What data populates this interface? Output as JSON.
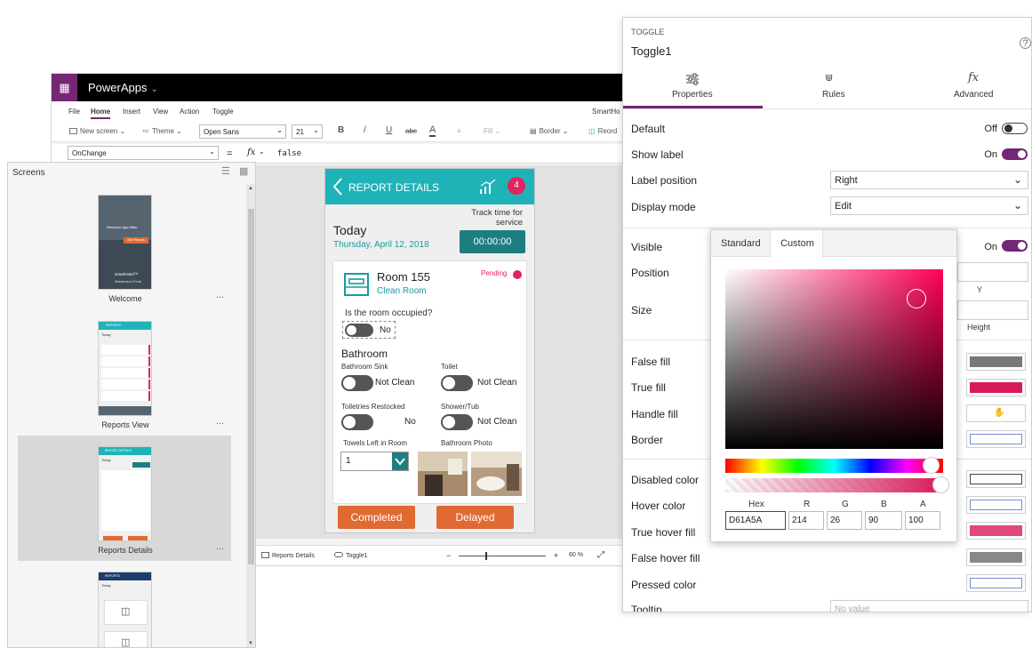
{
  "app": {
    "title": "PowerApps",
    "waffle": "waffle-icon",
    "chev": "⌄"
  },
  "menu": {
    "items": [
      "File",
      "Home",
      "Insert",
      "View",
      "Action",
      "Toggle"
    ],
    "active": "Home",
    "right": "SmartHo"
  },
  "toolbar": {
    "new_screen": "New screen ⌄",
    "theme": "Theme ⌄",
    "font": "Open Sans",
    "size": "21",
    "bold": "B",
    "italic": "/",
    "underline": "U",
    "strike": "abc",
    "color": "A",
    "align": "≡",
    "fill": "Fill ⌄",
    "border": "Border ⌄",
    "reorder": "Reord"
  },
  "formula": {
    "property": "OnChange",
    "eq": "=",
    "fx": "fx",
    "value": "false"
  },
  "screens_panel": {
    "title": "Screens",
    "items": [
      {
        "label": "Welcome",
        "title": "Welcome App Main",
        "btn": "See Reports",
        "brand": "smartHotel™",
        "sub": "Maintenance Portal"
      },
      {
        "label": "Reports View",
        "header": "REPORTS"
      },
      {
        "label": "Reports Details",
        "header": "REPORT DETAILS"
      },
      {
        "label": "",
        "header": "REPORTS"
      }
    ],
    "dots": "...",
    "today": "Today"
  },
  "phone": {
    "header_title": "REPORT DETAILS",
    "badge": "4",
    "today": "Today",
    "date": "Thursday, April 12, 2018",
    "track_label": "Track time for service",
    "timer": "00:00:00",
    "room": "Room 155",
    "room_sub": "Clean Room",
    "status": "Pending",
    "occupied_q": "Is the room occupied?",
    "occupied_val": "No",
    "bathroom": "Bathroom",
    "fields": [
      {
        "label": "Bathroom Sink",
        "value": "Not Clean"
      },
      {
        "label": "Toilet",
        "value": "Not Clean"
      },
      {
        "label": "Toiletries Restocked",
        "value": "No"
      },
      {
        "label": "Shower/Tub",
        "value": "Not Clean"
      }
    ],
    "towels_label": "Towels Left in Room",
    "towels_val": "1",
    "photo_label": "Bathroom Photo",
    "btn_completed": "Completed",
    "btn_delayed": "Delayed"
  },
  "status": {
    "screen": "Reports Details",
    "control": "Toggle1",
    "zoom": "60 %",
    "minus": "−",
    "plus": "+"
  },
  "props": {
    "type": "TOGGLE",
    "name": "Toggle1",
    "help": "?",
    "tabs": [
      {
        "label": "Properties",
        "icon": "properties-icon"
      },
      {
        "label": "Rules",
        "icon": "rules-icon"
      },
      {
        "label": "Advanced",
        "icon": "fx-icon"
      }
    ],
    "default_label": "Default",
    "default_val": "Off",
    "showlabel_label": "Show label",
    "showlabel_val": "On",
    "labelpos_label": "Label position",
    "labelpos_val": "Right",
    "displaymode_label": "Display mode",
    "displaymode_val": "Edit",
    "visible_label": "Visible",
    "visible_val": "On",
    "position_label": "Position",
    "y_label": "Y",
    "size_label": "Size",
    "height_label": "Height",
    "colors": [
      {
        "label": "False fill",
        "color": "#777777"
      },
      {
        "label": "True fill",
        "color": "#D61A5A"
      },
      {
        "label": "Handle fill",
        "color": "#FFFFFF"
      },
      {
        "label": "Border",
        "color": "#FFFFFF"
      },
      {
        "label": "Disabled color",
        "color": "#FFFFFF"
      },
      {
        "label": "Hover color",
        "color": "#FFFFFF"
      },
      {
        "label": "True hover fill",
        "color": "#E0487A"
      },
      {
        "label": "False hover fill",
        "color": "#888888"
      },
      {
        "label": "Pressed color",
        "color": "#FFFFFF"
      }
    ],
    "tooltip_label": "Tooltip",
    "tooltip_placeholder": "No value"
  },
  "picker": {
    "tabs": [
      "Standard",
      "Custom"
    ],
    "active": "Custom",
    "hex_label": "Hex",
    "r_label": "R",
    "g_label": "G",
    "b_label": "B",
    "a_label": "A",
    "hex": "D61A5A",
    "r": "214",
    "g": "26",
    "b": "90",
    "a": "100"
  },
  "colors": {
    "purple": "#742774",
    "teal": "#1fb3b8",
    "orange": "#e06a32"
  }
}
